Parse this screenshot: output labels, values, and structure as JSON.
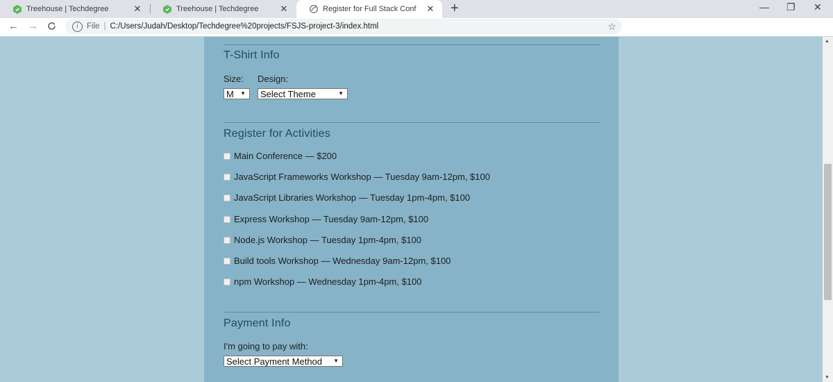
{
  "browser": {
    "tabs": [
      {
        "title": "Treehouse | Techdegree",
        "icon": "treehouse-icon"
      },
      {
        "title": "Treehouse | Techdegree",
        "icon": "treehouse-icon"
      },
      {
        "title": "Register for Full Stack Conf",
        "icon": "globe-icon"
      }
    ],
    "active_tab": 2,
    "new_tab_glyph": "+",
    "close_glyph": "✕",
    "nav": {
      "back": "←",
      "forward": "→",
      "reload": "C"
    },
    "address": {
      "scheme_label": "File",
      "url": "C:/Users/Judah/Desktop/Techdegree%20projects/FSJS-project-3/index.html"
    },
    "window_controls": {
      "minimize": "—",
      "restore": "❐",
      "close": "✕"
    }
  },
  "tshirt": {
    "legend": "T-Shirt Info",
    "size_label": "Size:",
    "size_value": "M",
    "design_label": "Design:",
    "design_value": "Select Theme"
  },
  "activities": {
    "legend": "Register for Activities",
    "items": [
      "Main Conference — $200",
      "JavaScript Frameworks Workshop — Tuesday 9am-12pm, $100",
      "JavaScript Libraries Workshop — Tuesday 1pm-4pm, $100",
      "Express Workshop — Tuesday 9am-12pm, $100",
      "Node.js Workshop — Tuesday 1pm-4pm, $100",
      "Build tools Workshop — Wednesday 9am-12pm, $100",
      "npm Workshop — Wednesday 1pm-4pm, $100"
    ]
  },
  "payment": {
    "legend": "Payment Info",
    "label": "I'm going to pay with:",
    "select_value": "Select Payment Method"
  },
  "colors": {
    "page_bg": "#abcbd8",
    "container_bg": "#86b3c8",
    "legend_text": "#204a61"
  }
}
